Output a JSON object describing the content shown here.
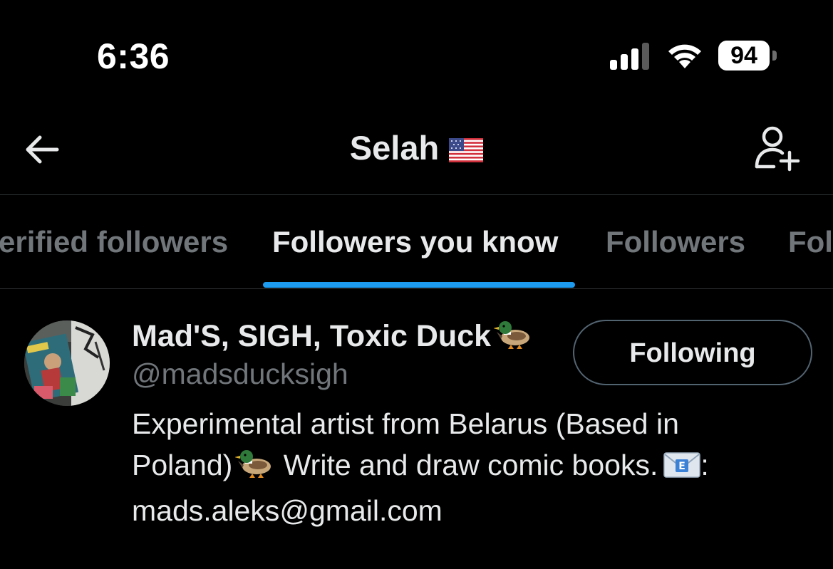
{
  "status_bar": {
    "time": "6:36",
    "battery_level": "94",
    "signal_bars_active": 3,
    "signal_bars_total": 4
  },
  "header": {
    "title": "Selah",
    "title_flag": "us-flag",
    "back_icon": "arrow-left-icon",
    "add_user_icon": "person-add-icon"
  },
  "tabs": [
    {
      "label": "Verified followers",
      "visible_label": "erified followers",
      "active": false
    },
    {
      "label": "Followers you know",
      "active": true
    },
    {
      "label": "Followers",
      "active": false
    },
    {
      "label": "Following",
      "visible_label": "Fol",
      "active": false
    }
  ],
  "accent_color": "#1d9bf0",
  "user": {
    "display_name": "Mad'S, SIGH, Toxic Duck",
    "name_emoji": "duck-emoji",
    "handle": "@madsducksigh",
    "follow_button_label": "Following",
    "bio_line1": "Experimental artist from Belarus (Based in",
    "bio_line2_a": "Poland)",
    "bio_line2_b": " Write and draw comic books.",
    "bio_line2_c": ":",
    "bio_line3": "mads.aleks@gmail.com",
    "bio_emojis": [
      "duck-emoji",
      "envelope-emoji"
    ]
  }
}
